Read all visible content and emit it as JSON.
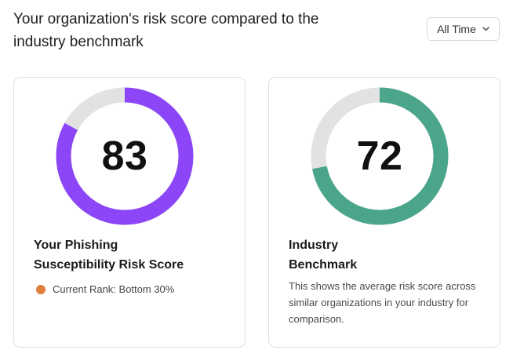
{
  "header": {
    "title": "Your organization's risk score compared to the industry benchmark"
  },
  "period_filter": {
    "selected": "All Time"
  },
  "cards": [
    {
      "score": 83,
      "score_label": "83",
      "title_line1": "Your Phishing",
      "title_line2": "Susceptibility Risk Score",
      "rank_text": "Current Rank: Bottom 30%",
      "gauge_color": "#8c45f7",
      "track_color": "#e2e2e2",
      "rank_dot_color": "#e07e3c"
    },
    {
      "score": 72,
      "score_label": "72",
      "title_line1": "Industry",
      "title_line2": "Benchmark",
      "description": "This shows the average risk score across similar organizations in your industry for comparison.",
      "gauge_color": "#4aa58a",
      "track_color": "#e2e2e2"
    }
  ]
}
